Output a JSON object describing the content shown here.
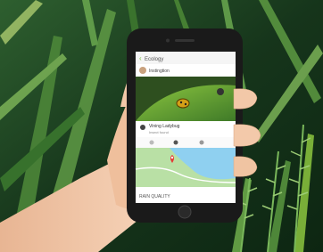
{
  "phone_app": {
    "header_title": "Ecology",
    "user_name": "Instingtion",
    "detail_title": "Vining Ladybug",
    "detail_subtitle": "Insect found",
    "footer_label": "RAIN QUALITY"
  },
  "colors": {
    "foliage_dark": "#16351b",
    "leaf_green": "#6aa84f",
    "phone_body": "#1a1a1a",
    "app_green": "#7ac142",
    "map_water": "#8fd0f0",
    "map_land": "#b9e0a5",
    "pin_red": "#e53935",
    "skin": "#f2c8a8"
  }
}
